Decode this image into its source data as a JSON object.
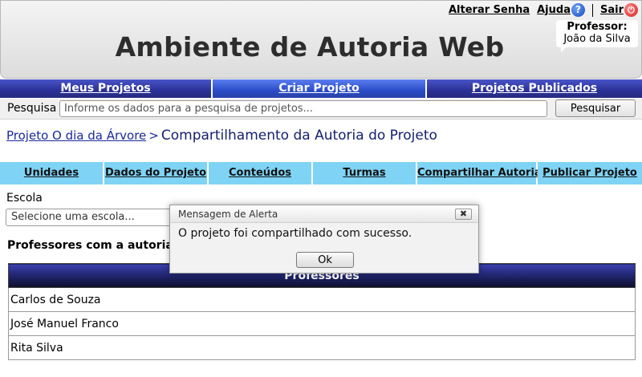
{
  "header": {
    "title": "Ambiente de Autoria Web",
    "change_password": "Alterar Senha",
    "help": "Ajuda",
    "logout": "Sair",
    "role": "Professor:",
    "user_name": "João da Silva"
  },
  "main_nav": {
    "items": [
      {
        "label": "Meus Projetos"
      },
      {
        "label": "Criar Projeto"
      },
      {
        "label": "Projetos Publicados"
      }
    ]
  },
  "search": {
    "label": "Pesquisa",
    "placeholder": "Informe os dados para a pesquisa de projetos...",
    "button": "Pesquisar"
  },
  "breadcrumb": {
    "project_link": "Projeto O dia da Árvore",
    "separator": ">",
    "current": "Compartilhamento da Autoria do Projeto"
  },
  "tabs": [
    {
      "label": "Unidades"
    },
    {
      "label": "Dados do Projeto"
    },
    {
      "label": "Conteúdos"
    },
    {
      "label": "Turmas"
    },
    {
      "label": "Compartilhar Autoria"
    },
    {
      "label": "Publicar Projeto"
    }
  ],
  "school": {
    "label": "Escola",
    "select_placeholder": "Selecione uma escola..."
  },
  "authors": {
    "section_title": "Professores com a autoria do projeto",
    "column_header": "Professores",
    "rows": [
      "Carlos de Souza",
      "José Manuel Franco",
      "Rita Silva"
    ]
  },
  "alert": {
    "title": "Mensagem de Alerta",
    "close": "✖",
    "message": "O projeto foi compartilhado com sucesso.",
    "ok": "Ok"
  },
  "colors": {
    "nav_blue": "#2b3196",
    "tab_cyan": "#7fd3f5",
    "breadcrumb_blue": "#1a2a9c"
  }
}
